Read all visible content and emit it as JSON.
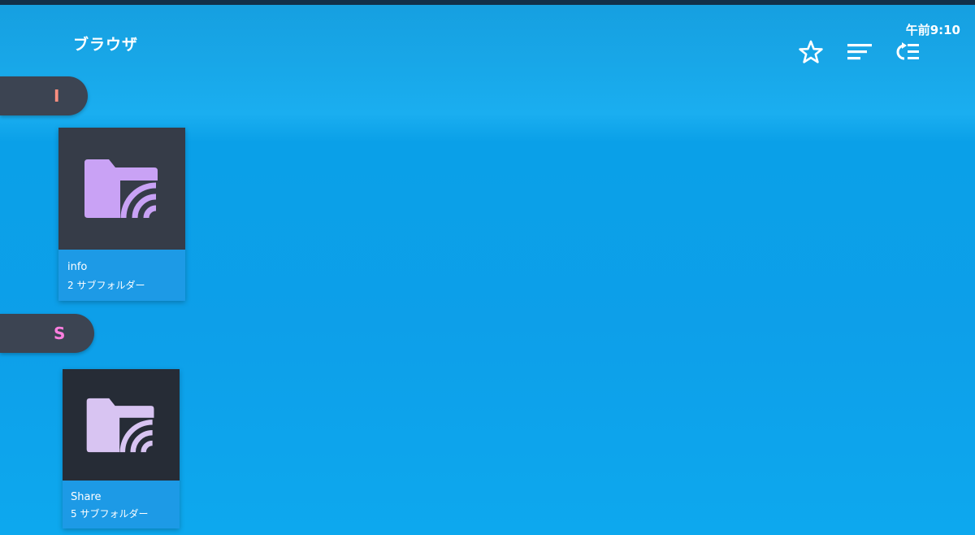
{
  "header": {
    "title": "ブラウザ",
    "clock": "午前9:10",
    "actions": [
      {
        "name": "favorites",
        "icon": "star-icon"
      },
      {
        "name": "sort",
        "icon": "sort-icon"
      },
      {
        "name": "view-mode",
        "icon": "list-view-icon"
      }
    ]
  },
  "sections": [
    {
      "letter": "I",
      "letter_color": "#ff8f80",
      "folders": [
        {
          "name": "info",
          "subfolders": "2 サブフォルダー",
          "icon": "network-folder-icon"
        }
      ]
    },
    {
      "letter": "S",
      "letter_color": "#ff7fe0",
      "folders": [
        {
          "name": "Share",
          "subfolders": "5 サブフォルダー",
          "icon": "network-folder-icon"
        }
      ]
    }
  ],
  "colors": {
    "background": "#0da4ec",
    "card_thumb": "#363c48",
    "card_info": "#1d9ae6",
    "folder_icon": "#c9a2f5",
    "section_bar": "#3c4452"
  }
}
